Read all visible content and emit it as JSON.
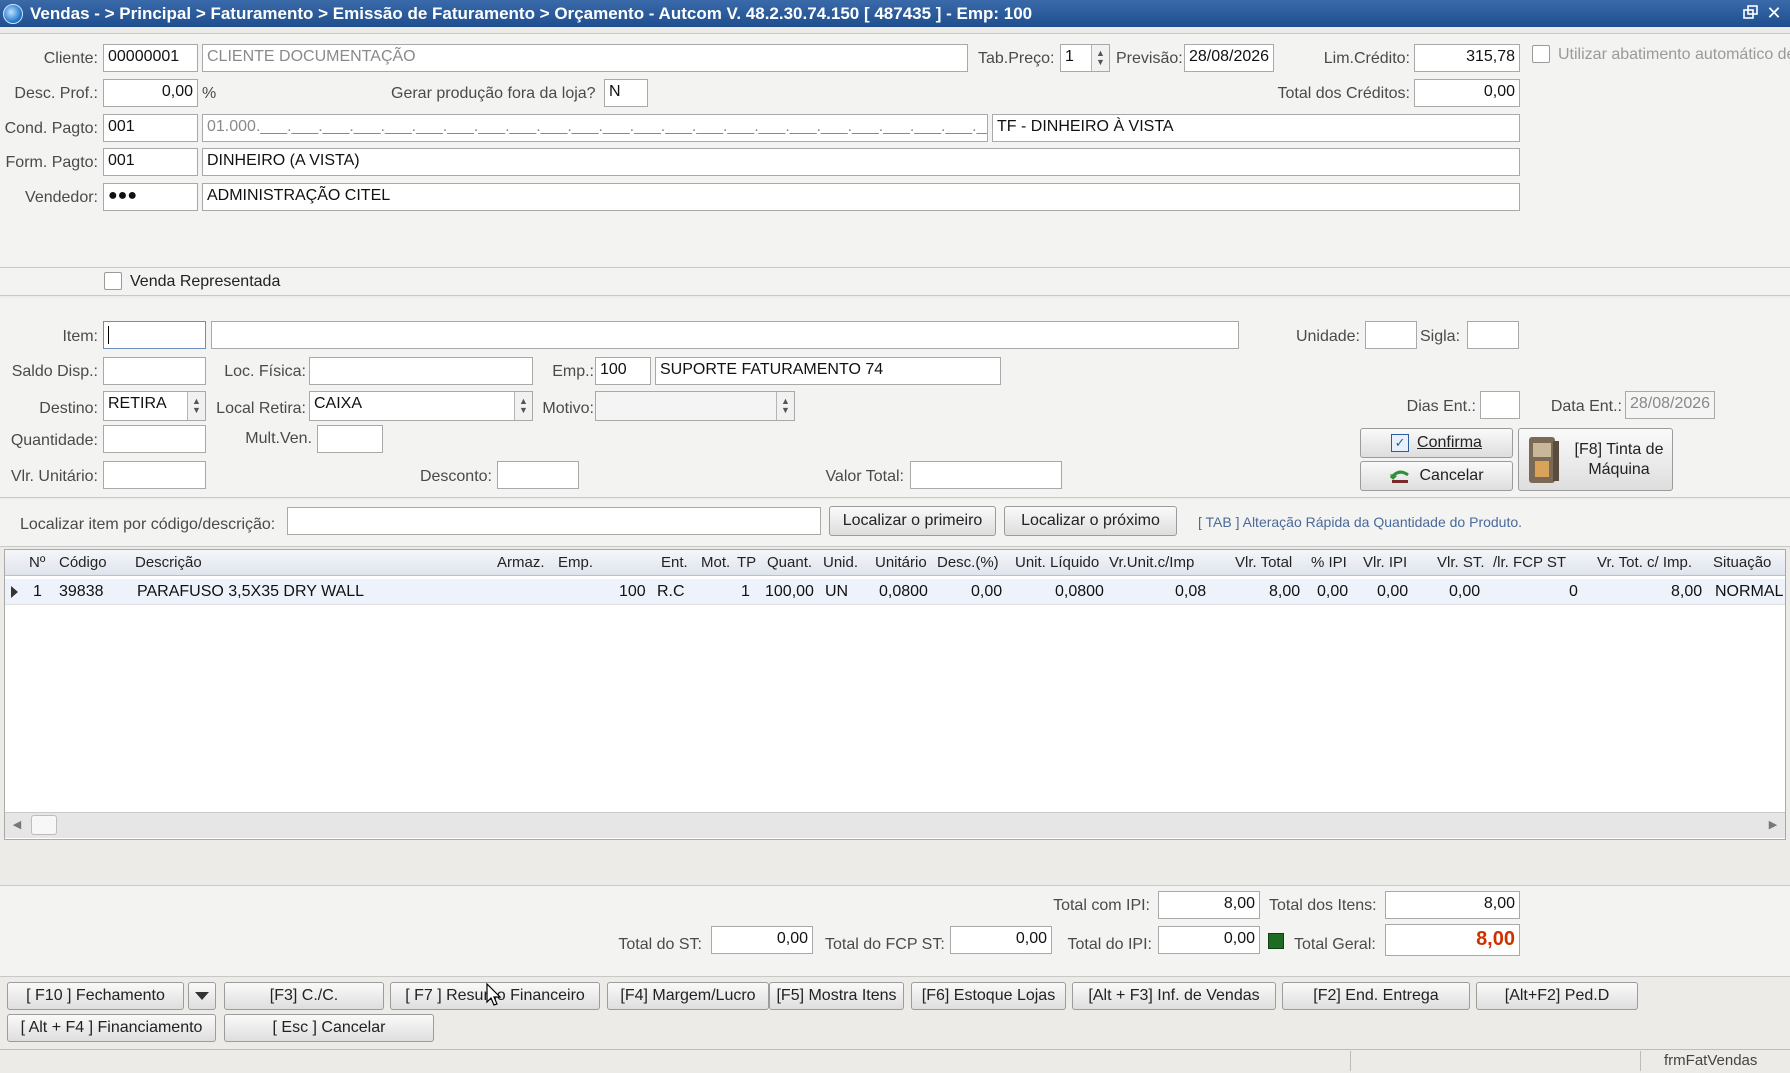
{
  "window": {
    "title": "Vendas -  > Principal > Faturamento > Emissão de Faturamento > Orçamento  -   Autcom V. 48.2.30.74.150 [ 487435 ] - Emp: 100"
  },
  "header": {
    "cliente_label": "Cliente:",
    "cliente_code": "00000001",
    "cliente_name": "CLIENTE DOCUMENTAÇÃO",
    "tab_preco_label": "Tab.Preço:",
    "tab_preco_value": "1",
    "previsao_label": "Previsão:",
    "previsao_value": "28/08/2026",
    "lim_credito_label": "Lim.Crédito:",
    "lim_credito_value": "315,78",
    "abatimento_label": "Utilizar abatimento automático de",
    "desc_prof_label": "Desc. Prof.:",
    "desc_prof_value": "0,00",
    "percent_sign": "%",
    "gerar_producao_label": "Gerar produção fora da loja?",
    "gerar_producao_value": "N",
    "total_creditos_label": "Total dos Créditos:",
    "total_creditos_value": "0,00",
    "cond_pagto_label": "Cond. Pagto:",
    "cond_pagto_code": "001",
    "cond_pagto_mask": "01.000.___.___.___.___.___.___.___.___.___.___.___.___.___.___.___.___.___.___.___.___.___.___.___.___.___",
    "cond_pagto_desc": "TF - DINHEIRO À VISTA",
    "form_pagto_label": "Form. Pagto:",
    "form_pagto_code": "001",
    "form_pagto_desc": "DINHEIRO (A VISTA)",
    "vendedor_label": "Vendedor:",
    "vendedor_code": "●●●",
    "vendedor_name": "ADMINISTRAÇÃO CITEL",
    "venda_representada_label": "Venda Representada"
  },
  "item_form": {
    "item_label": "Item:",
    "item_code": "",
    "item_desc": "",
    "unidade_label": "Unidade:",
    "sigla_label": "Sigla:",
    "saldo_label": "Saldo Disp.:",
    "loc_fisica_label": "Loc. Física:",
    "emp_label": "Emp.:",
    "emp_code": "100",
    "emp_name": "SUPORTE FATURAMENTO 74",
    "destino_label": "Destino:",
    "destino_value": "RETIRA",
    "local_retira_label": "Local Retira:",
    "local_retira_value": "CAIXA",
    "motivo_label": "Motivo:",
    "dias_ent_label": "Dias Ent.:",
    "data_ent_label": "Data Ent.:",
    "data_ent_value": "28/08/2026",
    "quantidade_label": "Quantidade:",
    "mult_ven_label": "Mult.Ven.",
    "vlr_unitario_label": "Vlr. Unitário:",
    "desconto_label": "Desconto:",
    "valor_total_label": "Valor Total:",
    "confirma_label": "Confirma",
    "cancelar_label": "Cancelar",
    "tinta_label": "[F8] Tinta de Máquina"
  },
  "search": {
    "label": "Localizar item por código/descrição:",
    "value": "",
    "first_button": "Localizar o primeiro",
    "next_button": "Localizar o próximo",
    "hint": "[ TAB ] Alteração Rápida da Quantidade do Produto."
  },
  "grid": {
    "columns": [
      "Nº",
      "Código",
      "Descrição",
      "Armaz.",
      "Emp.",
      "Ent.",
      "Mot.",
      "TP",
      "Quant.",
      "Unid.",
      "Unitário",
      "Desc.(%)",
      "Unit. Líquido",
      "Vr.Unit.c/Imp",
      "Vlr. Total",
      "% IPI",
      "Vlr. IPI",
      "Vlr. ST.",
      "/lr. FCP ST",
      "Vr. Tot. c/ Imp.",
      "Situação"
    ],
    "rows": [
      [
        "1",
        "39838",
        "PARAFUSO 3,5X35 DRY WALL",
        "",
        "100",
        "R.C",
        "",
        "1",
        "100,00",
        "UN",
        "0,0800",
        "0,00",
        "0,0800",
        "0,08",
        "8,00",
        "0,00",
        "0,00",
        "0,00",
        "0",
        "8,00",
        "NORMAL"
      ]
    ]
  },
  "totals": {
    "total_com_ipi_label": "Total com IPI:",
    "total_com_ipi_value": "8,00",
    "total_itens_label": "Total dos Itens:",
    "total_itens_value": "8,00",
    "total_st_label": "Total do ST:",
    "total_st_value": "0,00",
    "total_fcp_label": "Total do FCP ST:",
    "total_fcp_value": "0,00",
    "total_ipi_label": "Total do IPI:",
    "total_ipi_value": "0,00",
    "total_geral_label": "Total Geral:",
    "total_geral_value": "8,00",
    "total_geral_color": "#cc3300"
  },
  "buttons": {
    "fechamento": "[ F10 ] Fechamento",
    "cc": "[F3] C./C.",
    "resumo": "[ F7 ] Resumo Financeiro",
    "margem": "[F4] Margem/Lucro",
    "mostra_itens": "[F5] Mostra Itens",
    "estoque": "[F6] Estoque Lojas",
    "inf_vendas": "[Alt + F3] Inf. de Vendas",
    "end_entrega": "[F2] End. Entrega",
    "ped_d": "[Alt+F2] Ped.D",
    "financiamento": "[ Alt + F4 ] Financiamento",
    "cancelar": "[ Esc ] Cancelar"
  },
  "status": {
    "form_name": "frmFatVendas"
  }
}
